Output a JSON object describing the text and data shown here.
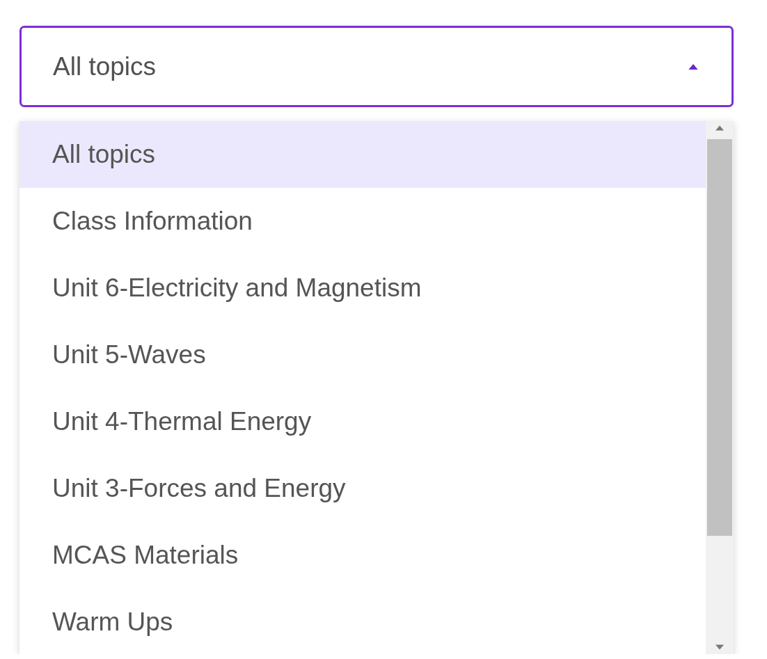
{
  "topic_select": {
    "value": "All topics",
    "expanded": true,
    "options": [
      {
        "label": "All topics",
        "selected": true
      },
      {
        "label": "Class Information",
        "selected": false
      },
      {
        "label": "Unit 6-Electricity and Magnetism",
        "selected": false
      },
      {
        "label": "Unit 5-Waves",
        "selected": false
      },
      {
        "label": "Unit 4-Thermal Energy",
        "selected": false
      },
      {
        "label": "Unit 3-Forces and Energy",
        "selected": false
      },
      {
        "label": "MCAS Materials",
        "selected": false
      },
      {
        "label": "Warm Ups",
        "selected": false
      }
    ]
  }
}
